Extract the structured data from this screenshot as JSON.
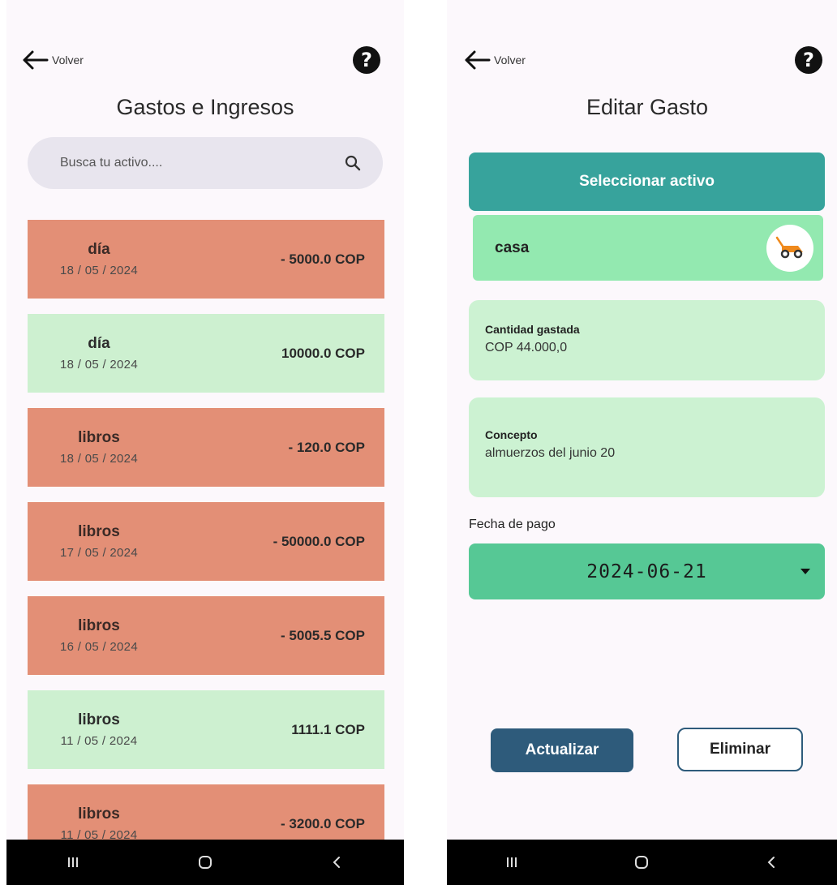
{
  "left": {
    "back_label": "Volver",
    "help_symbol": "?",
    "title": "Gastos e Ingresos",
    "search": {
      "placeholder": "Busca tu activo...."
    },
    "transactions": [
      {
        "name": "día",
        "date": "18 / 05 / 2024",
        "amount": "- 5000.0 COP",
        "kind": "expense"
      },
      {
        "name": "día",
        "date": "18 / 05 / 2024",
        "amount": "10000.0 COP",
        "kind": "income"
      },
      {
        "name": "libros",
        "date": "18 / 05 / 2024",
        "amount": "- 120.0 COP",
        "kind": "expense"
      },
      {
        "name": "libros",
        "date": "17 / 05 / 2024",
        "amount": "- 50000.0 COP",
        "kind": "expense"
      },
      {
        "name": "libros",
        "date": "16 / 05 / 2024",
        "amount": "- 5005.5 COP",
        "kind": "expense"
      },
      {
        "name": "libros",
        "date": "11 / 05 / 2024",
        "amount": "1111.1 COP",
        "kind": "income"
      },
      {
        "name": "libros",
        "date": "11 / 05 / 2024",
        "amount": "- 3200.0 COP",
        "kind": "expense"
      }
    ]
  },
  "right": {
    "back_label": "Volver",
    "help_symbol": "?",
    "title": "Editar Gasto",
    "select_asset_label": "Seleccionar activo",
    "asset": {
      "name": "casa",
      "icon": "lawn-mower-icon"
    },
    "amount_field": {
      "label": "Cantidad gastada",
      "value": "COP 44.000,0"
    },
    "concept_field": {
      "label": "Concepto",
      "value": "almuerzos del junio 20"
    },
    "date_label": "Fecha de pago",
    "date_value": "2024-06-21",
    "update_label": "Actualizar",
    "delete_label": "Eliminar"
  },
  "colors": {
    "expense": "#e38f76",
    "income": "#cdf0d0",
    "teal": "#37a39c",
    "asset_bg": "#93e9b0",
    "date_bg": "#56c895",
    "primary_button": "#2e5b7b"
  }
}
